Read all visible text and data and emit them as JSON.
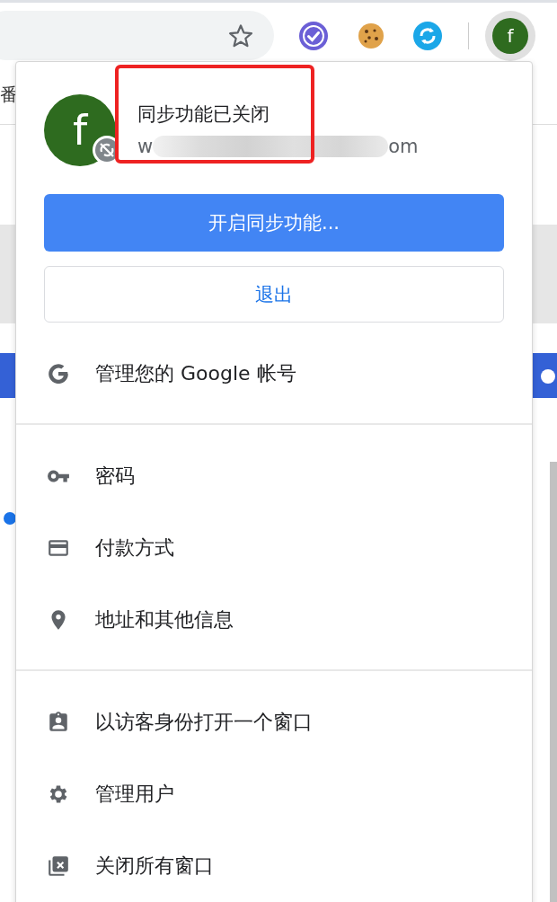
{
  "background": {
    "text": "番",
    "toggle_on": true
  },
  "toolbar": {
    "avatar_initial": "f"
  },
  "profile": {
    "initial": "f",
    "sync_off": true,
    "title": "同步功能已关闭",
    "email_start": "w",
    "email_end": "om"
  },
  "sync_button": "开启同步功能...",
  "signout_button": "退出",
  "sections": [
    [
      {
        "kind": "google",
        "label": "管理您的 Google 帐号"
      }
    ],
    [
      {
        "kind": "key",
        "label": "密码"
      },
      {
        "kind": "card",
        "label": "付款方式"
      },
      {
        "kind": "pin",
        "label": "地址和其他信息"
      }
    ],
    [
      {
        "kind": "guest",
        "label": "以访客身份打开一个窗口"
      },
      {
        "kind": "gear",
        "label": "管理用户"
      },
      {
        "kind": "close-windows",
        "label": "关闭所有窗口"
      }
    ]
  ]
}
